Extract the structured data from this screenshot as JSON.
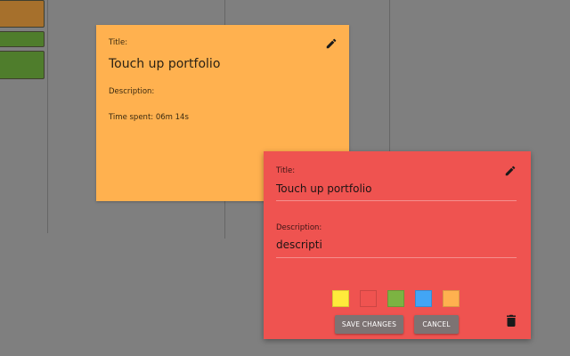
{
  "colors": {
    "background": "#7f7f7f",
    "view_card": "#ffb14f",
    "edit_card": "#ef5350",
    "button": "#7d7373"
  },
  "background_blocks": [
    {
      "color": "#a6702c"
    },
    {
      "color": "#4f7d2c"
    },
    {
      "color": "#4f7d2c"
    }
  ],
  "view_card": {
    "title_label": "Title:",
    "title": "Touch up portfolio",
    "description_label": "Description:",
    "time_spent": "Time spent: 06m 14s",
    "edit_icon": "pencil-icon"
  },
  "edit_card": {
    "title_label": "Title:",
    "title_value": "Touch up portfolio",
    "description_label": "Description:",
    "description_value": "descripti",
    "edit_icon": "pencil-icon",
    "color_options": [
      {
        "name": "yellow",
        "color": "#ffeb3b"
      },
      {
        "name": "red",
        "color": "#ef5350"
      },
      {
        "name": "green",
        "color": "#7cb342"
      },
      {
        "name": "blue",
        "color": "#42a5f5"
      },
      {
        "name": "orange",
        "color": "#ffb14f"
      }
    ],
    "save_label": "SAVE CHANGES",
    "cancel_label": "CANCEL",
    "delete_icon": "trash-icon"
  }
}
